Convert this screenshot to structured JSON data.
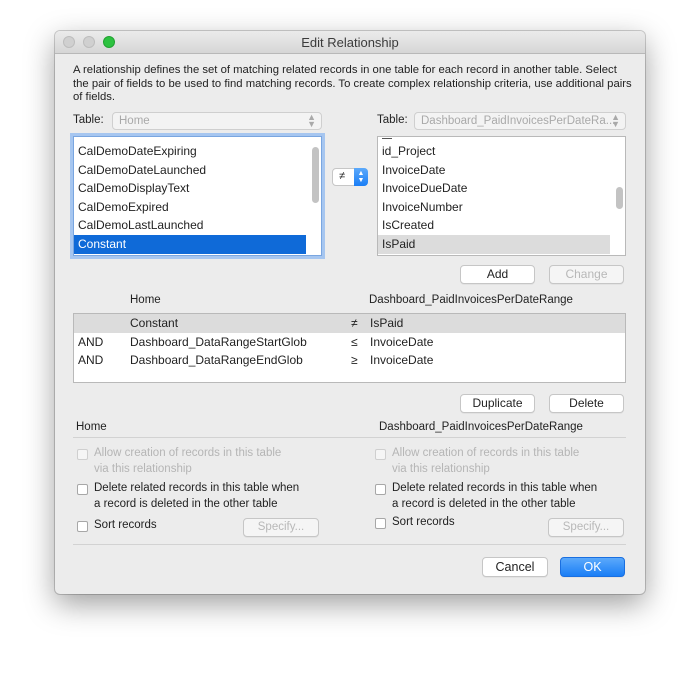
{
  "window": {
    "title": "Edit Relationship"
  },
  "description": "A relationship defines the set of matching related records in one table for each record in another table. Select the pair of fields to be used to find matching records. To create complex relationship criteria, use additional pairs of fields.",
  "left_table": {
    "label": "Table:",
    "value": "Home",
    "fields": [
      "CalDemoDateExpiring",
      "CalDemoDateLaunched",
      "CalDemoDisplayText",
      "CalDemoExpired",
      "CalDemoLastLaunched",
      "Constant"
    ],
    "selected_index": 5
  },
  "operator": {
    "symbol": "≠"
  },
  "right_table": {
    "label": "Table:",
    "value": "Dashboard_PaidInvoicesPerDateRa...",
    "fields": [
      "id_Project",
      "InvoiceDate",
      "InvoiceDueDate",
      "InvoiceNumber",
      "IsCreated",
      "IsPaid"
    ],
    "selected_index": 5
  },
  "buttons": {
    "add": "Add",
    "change": "Change",
    "duplicate": "Duplicate",
    "delete": "Delete",
    "cancel": "Cancel",
    "ok": "OK"
  },
  "criteria": {
    "header_left": "Home",
    "header_right": "Dashboard_PaidInvoicesPerDateRange",
    "rows": [
      {
        "conj": "",
        "left": "Constant",
        "op": "≠",
        "right": "IsPaid"
      },
      {
        "conj": "AND",
        "left": "Dashboard_DataRangeStartGlob",
        "op": "≤",
        "right": "InvoiceDate"
      },
      {
        "conj": "AND",
        "left": "Dashboard_DataRangeEndGlob",
        "op": "≥",
        "right": "InvoiceDate"
      }
    ]
  },
  "options_left": {
    "heading": "Home",
    "allow_line1": "Allow creation of records in this table",
    "allow_line2": "via this relationship",
    "delete_line1": "Delete related records in this table when",
    "delete_line2": "a record is deleted in the other table",
    "sort": "Sort records",
    "specify": "Specify..."
  },
  "options_right": {
    "heading": "Dashboard_PaidInvoicesPerDateRange",
    "allow_line1": "Allow creation of records in this table",
    "allow_line2": "via this relationship",
    "delete_line1": "Delete related records in this table when",
    "delete_line2": "a record is deleted in the other table",
    "sort": "Sort records",
    "specify": "Specify..."
  }
}
